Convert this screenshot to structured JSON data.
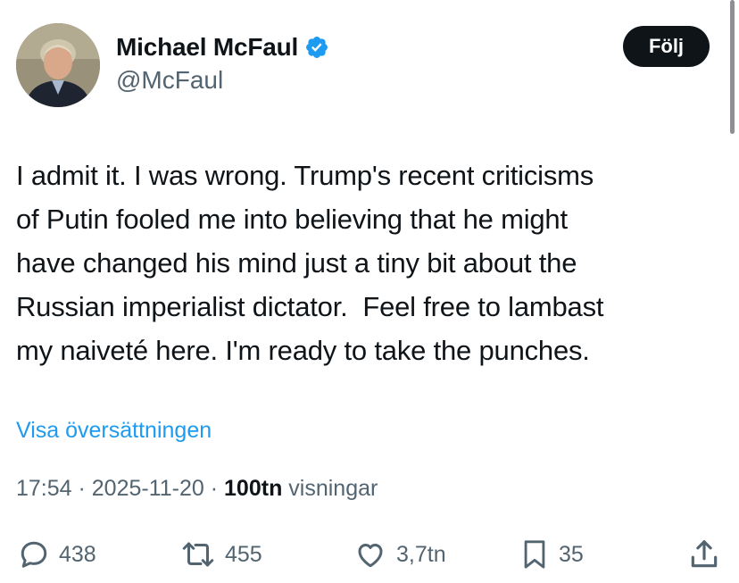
{
  "author": {
    "display_name": "Michael McFaul",
    "handle": "@McFaul",
    "verified_icon": "verified-badge-icon",
    "verified_color": "#1d9bf0"
  },
  "follow_button": {
    "label": "Följ"
  },
  "tweet": {
    "text": "I admit it. I was wrong. Trump's recent criticisms\nof Putin fooled me into believing that he might\nhave changed his mind just a tiny bit about the\nRussian imperialist dictator.  Feel free to lambast\nmy naiveté here. I'm ready to take the punches.",
    "translate_label": "Visa översättningen"
  },
  "meta": {
    "time": "17:54",
    "separator1": " · ",
    "date": "2025-11-20",
    "separator2": " · ",
    "views_count": "100tn",
    "views_label": " visningar"
  },
  "actions": {
    "replies": {
      "icon": "reply-icon",
      "count": "438"
    },
    "reposts": {
      "icon": "repost-icon",
      "count": "455"
    },
    "likes": {
      "icon": "heart-icon",
      "count": "3,7tn"
    },
    "bookmarks": {
      "icon": "bookmark-icon",
      "count": "35"
    },
    "share": {
      "icon": "share-icon"
    }
  },
  "colors": {
    "text": "#0f1419",
    "secondary": "#536471",
    "link": "#1d9bf0",
    "follow_bg": "#0f1419"
  }
}
